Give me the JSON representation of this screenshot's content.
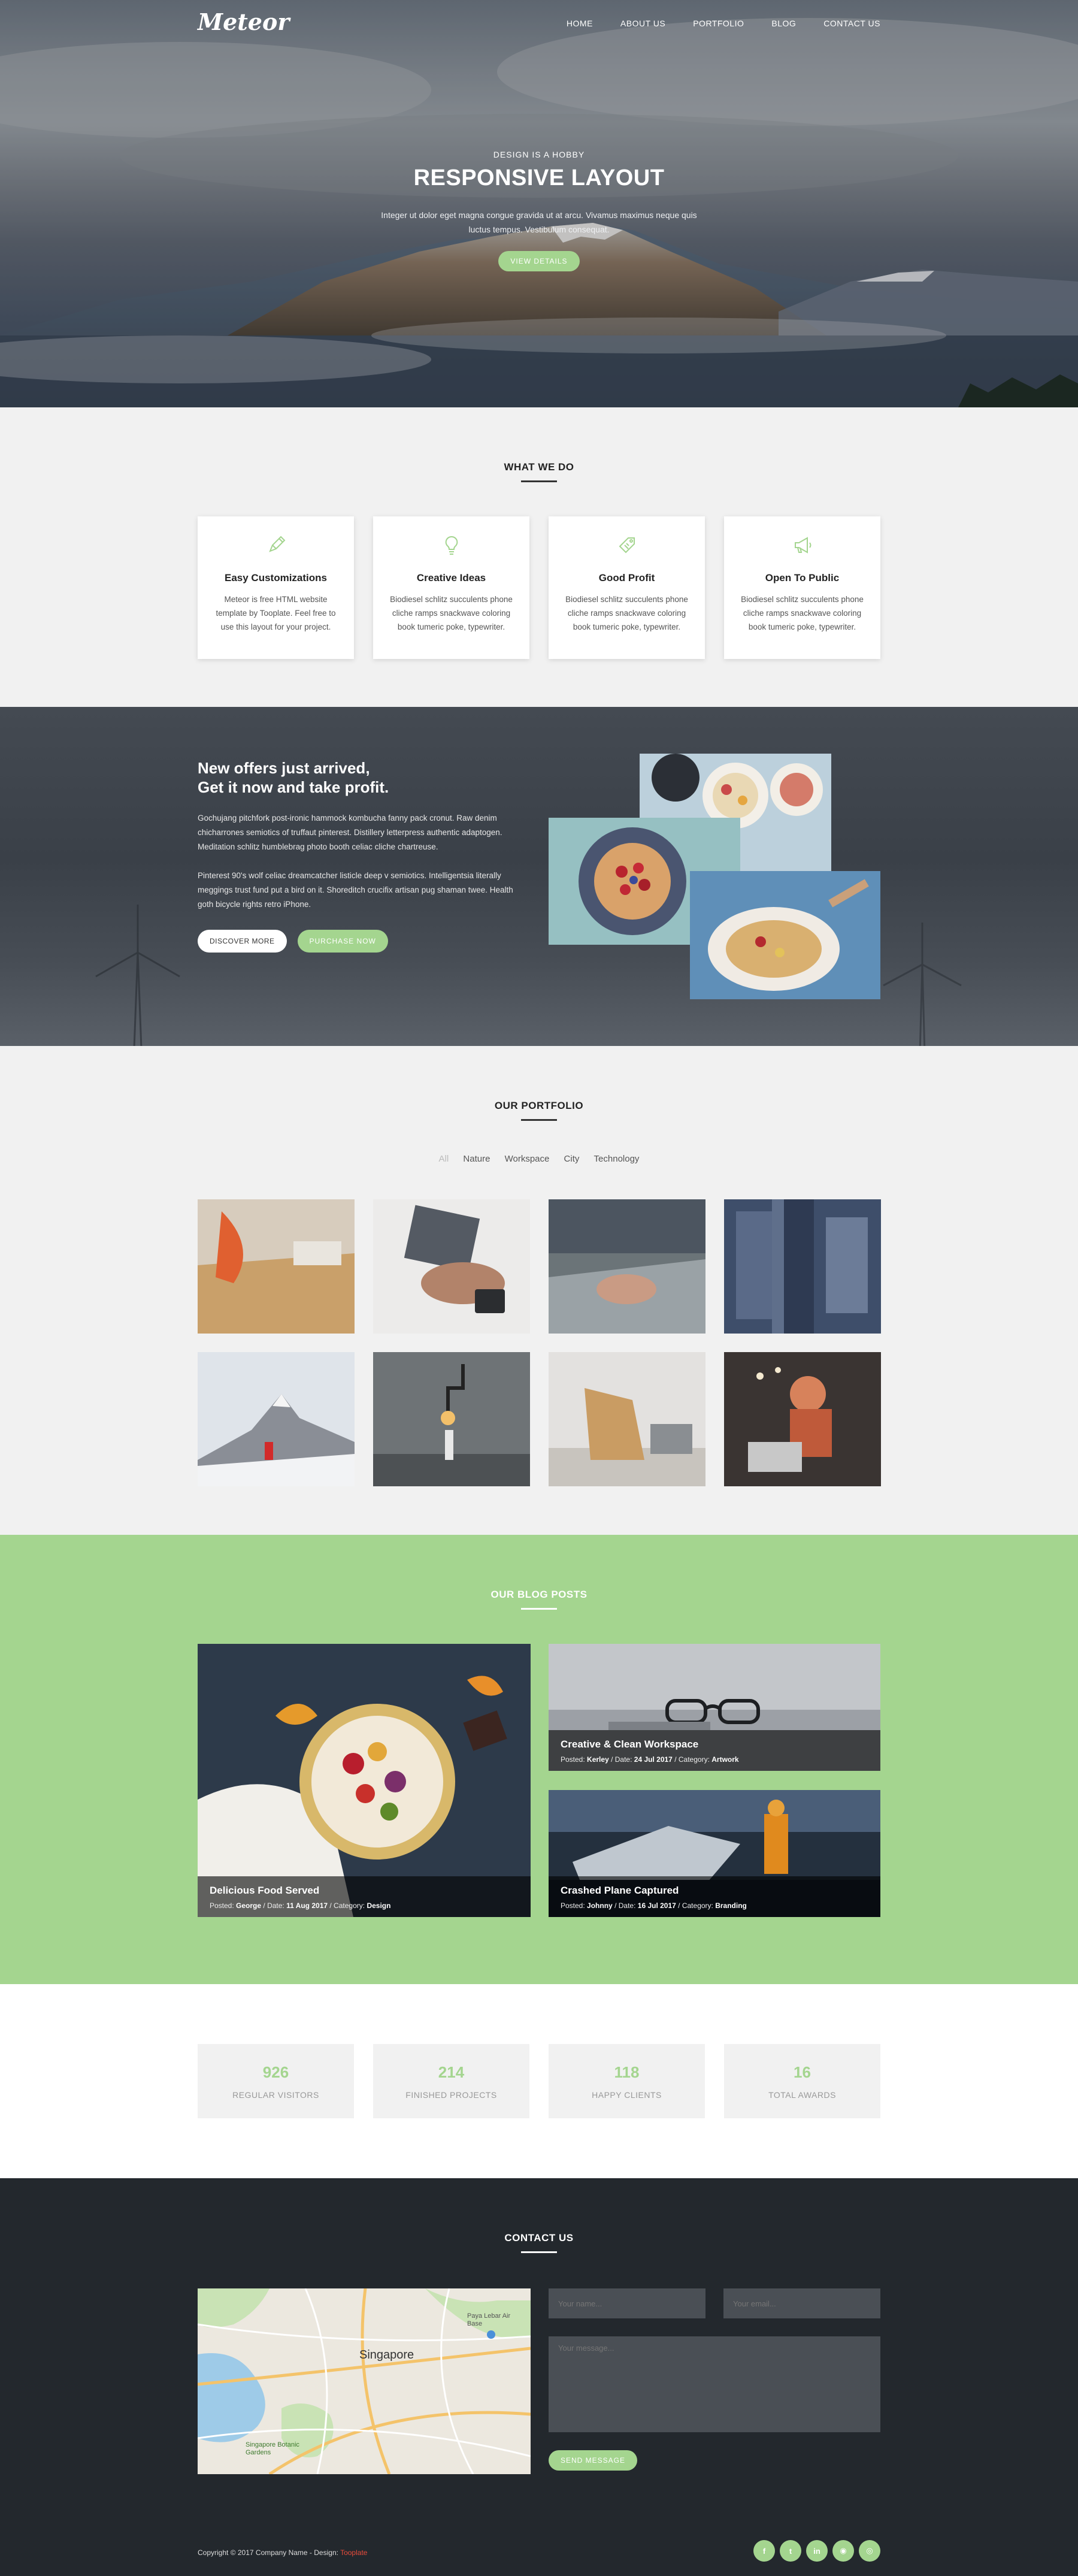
{
  "nav": {
    "logo": "Meteor",
    "items": [
      "HOME",
      "ABOUT US",
      "PORTFOLIO",
      "BLOG",
      "CONTACT US"
    ]
  },
  "hero": {
    "kicker": "DESIGN IS A HOBBY",
    "title": "RESPONSIVE LAYOUT",
    "description": "Integer ut dolor eget magna congue gravida ut at arcu. Vivamus maximus neque quis luctus tempus. Vestibulum consequat.",
    "button": "VIEW DETAILS"
  },
  "services": {
    "title": "WHAT WE DO",
    "cards": [
      {
        "icon": "pencil-icon",
        "title": "Easy Customizations",
        "text": "Meteor is free HTML website template by Tooplate. Feel free to use this layout for your project."
      },
      {
        "icon": "lightbulb-icon",
        "title": "Creative Ideas",
        "text": "Biodiesel schlitz succulents phone cliche ramps snackwave coloring book tumeric poke, typewriter."
      },
      {
        "icon": "tag-icon",
        "title": "Good Profit",
        "text": "Biodiesel schlitz succulents phone cliche ramps snackwave coloring book tumeric poke, typewriter."
      },
      {
        "icon": "megaphone-icon",
        "title": "Open To Public",
        "text": "Biodiesel schlitz succulents phone cliche ramps snackwave coloring book tumeric poke, typewriter."
      }
    ]
  },
  "offers": {
    "title_line1": "New offers just arrived,",
    "title_line2": "Get it now and take profit.",
    "paragraph1": "Gochujang pitchfork post-ironic hammock kombucha fanny pack cronut. Raw denim chicharrones semiotics of truffaut pinterest. Distillery letterpress authentic adaptogen. Meditation schlitz humblebrag photo booth celiac cliche chartreuse.",
    "paragraph2": "Pinterest 90's wolf celiac dreamcatcher listicle deep v semiotics. Intelligentsia literally meggings trust fund put a bird on it. Shoreditch crucifix artisan pug shaman twee. Health goth bicycle rights retro iPhone.",
    "btn_discover": "DISCOVER MORE",
    "btn_purchase": "PURCHASE NOW"
  },
  "portfolio": {
    "title": "OUR PORTFOLIO",
    "filters": [
      "All",
      "Nature",
      "Workspace",
      "City",
      "Technology"
    ],
    "active_filter": "All"
  },
  "blog": {
    "title": "OUR BLOG POSTS",
    "posts": [
      {
        "title": "Delicious Food Served",
        "author": "George",
        "date": "11 Aug 2017",
        "category": "Design"
      },
      {
        "title": "Creative & Clean Workspace",
        "author": "Kerley",
        "date": "24 Jul 2017",
        "category": "Artwork"
      },
      {
        "title": "Crashed Plane Captured",
        "author": "Johnny",
        "date": "16 Jul 2017",
        "category": "Branding"
      }
    ],
    "labels": {
      "posted": "Posted:",
      "date": "/ Date:",
      "category": "/ Category:"
    }
  },
  "stats": [
    {
      "value": "926",
      "label": "REGULAR VISITORS"
    },
    {
      "value": "214",
      "label": "FINISHED PROJECTS"
    },
    {
      "value": "118",
      "label": "HAPPY CLIENTS"
    },
    {
      "value": "16",
      "label": "TOTAL AWARDS"
    }
  ],
  "contact": {
    "title": "CONTACT US",
    "map_city": "Singapore",
    "map_labels": [
      "Paya Lebar Air Base",
      "Singapore Botanic Gardens"
    ],
    "name_placeholder": "Your name...",
    "email_placeholder": "Your email...",
    "message_placeholder": "Your message...",
    "send": "SEND MESSAGE"
  },
  "footer": {
    "copyright": "Copyright © 2017 Company Name - Design:",
    "designer": "Tooplate",
    "socials": [
      "facebook-icon",
      "twitter-icon",
      "linkedin-icon",
      "rss-icon",
      "instagram-icon"
    ]
  },
  "colors": {
    "accent": "#a4d58f",
    "dark": "#23282d",
    "light_bg": "#f1f1f1"
  }
}
